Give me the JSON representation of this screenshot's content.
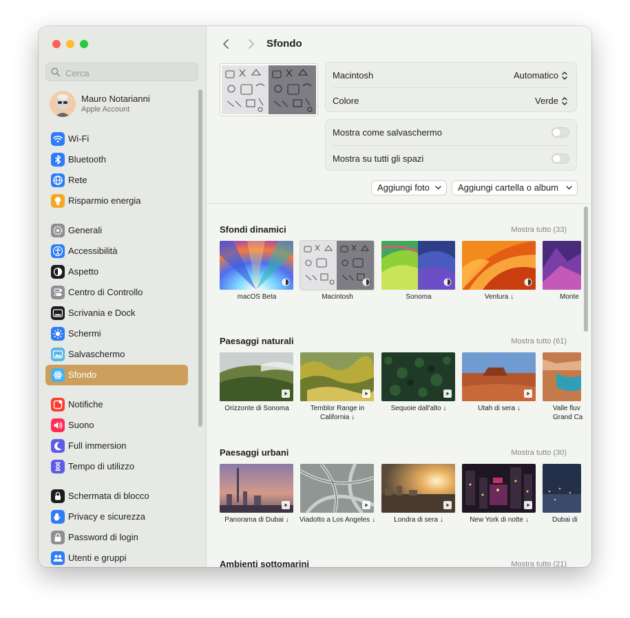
{
  "search": {
    "placeholder": "Cerca"
  },
  "account": {
    "name": "Mauro Notarianni",
    "subtitle": "Apple Account"
  },
  "sidebar": {
    "items": [
      {
        "label": "Wi-Fi",
        "icon": "wifi-icon",
        "color": "#2e7cf6"
      },
      {
        "label": "Bluetooth",
        "icon": "bluetooth-icon",
        "color": "#2e7cf6"
      },
      {
        "label": "Rete",
        "icon": "globe-icon",
        "color": "#2e7cf6"
      },
      {
        "label": "Risparmio energia",
        "icon": "battery-icon",
        "color": "#f5a623"
      },
      {
        "label": "Generali",
        "icon": "gear-icon",
        "color": "#8e8e93"
      },
      {
        "label": "Accessibilità",
        "icon": "accessibility-icon",
        "color": "#2e7cf6"
      },
      {
        "label": "Aspetto",
        "icon": "appearance-icon",
        "color": "#1c1c1e"
      },
      {
        "label": "Centro di Controllo",
        "icon": "control-center-icon",
        "color": "#8e8e93"
      },
      {
        "label": "Scrivania e Dock",
        "icon": "dock-icon",
        "color": "#1c1c1e"
      },
      {
        "label": "Schermi",
        "icon": "sun-icon",
        "color": "#2e7cf6"
      },
      {
        "label": "Salvaschermo",
        "icon": "screensaver-icon",
        "color": "#5ab4e8"
      },
      {
        "label": "Sfondo",
        "icon": "wallpaper-icon",
        "color": "#45b2f0"
      },
      {
        "label": "Notifiche",
        "icon": "bell-icon",
        "color": "#ff3b30"
      },
      {
        "label": "Suono",
        "icon": "speaker-icon",
        "color": "#ff2d55"
      },
      {
        "label": "Full immersion",
        "icon": "moon-icon",
        "color": "#5e5ce6"
      },
      {
        "label": "Tempo di utilizzo",
        "icon": "hourglass-icon",
        "color": "#5e5ce6"
      },
      {
        "label": "Schermata di blocco",
        "icon": "lock-icon",
        "color": "#1c1c1e"
      },
      {
        "label": "Privacy e sicurezza",
        "icon": "hand-icon",
        "color": "#2e7cf6"
      },
      {
        "label": "Password di login",
        "icon": "padlock-icon",
        "color": "#8e8e93"
      },
      {
        "label": "Utenti e gruppi",
        "icon": "users-icon",
        "color": "#2e7cf6"
      }
    ],
    "active_item": "Sfondo",
    "active_color": "#cc9f5d"
  },
  "header": {
    "title": "Sfondo"
  },
  "settings": {
    "wallpaper_label": "Macintosh",
    "wallpaper_value": "Automatico",
    "color_label": "Colore",
    "color_value": "Verde",
    "screensaver_label": "Mostra come salvaschermo",
    "screensaver_on": false,
    "all_spaces_label": "Mostra su tutti gli spazi",
    "all_spaces_on": false
  },
  "buttons": {
    "add_photo": "Aggiungi foto",
    "add_folder": "Aggiungi cartella o album"
  },
  "sections": [
    {
      "title": "Sfondi dinamici",
      "show_all": "Mostra tutto (33)",
      "items": [
        {
          "label": "macOS Beta",
          "badge": "dynamic-icon"
        },
        {
          "label": "Macintosh",
          "badge": "dynamic-icon"
        },
        {
          "label": "Sonoma",
          "badge": "dynamic-icon"
        },
        {
          "label": "Ventura ↓",
          "badge": "dynamic-icon"
        },
        {
          "label": "Monte",
          "badge": ""
        }
      ]
    },
    {
      "title": "Paesaggi naturali",
      "show_all": "Mostra tutto (61)",
      "items": [
        {
          "label": "Orizzonte di Sonoma",
          "badge": "play-icon"
        },
        {
          "label": "Temblor Range in California ↓",
          "badge": "play-icon"
        },
        {
          "label": "Sequoie dall'alto ↓",
          "badge": "play-icon"
        },
        {
          "label": "Utah di sera ↓",
          "badge": "play-icon"
        },
        {
          "label": "Valle fluv Grand Ca",
          "badge": ""
        }
      ]
    },
    {
      "title": "Paesaggi urbani",
      "show_all": "Mostra tutto (30)",
      "items": [
        {
          "label": "Panorama di Dubai ↓",
          "badge": "play-icon"
        },
        {
          "label": "Viadotto a Los Angeles ↓",
          "badge": "play-icon"
        },
        {
          "label": "Londra di sera ↓",
          "badge": "play-icon"
        },
        {
          "label": "New York di notte ↓",
          "badge": "play-icon"
        },
        {
          "label": "Dubai di",
          "badge": ""
        }
      ]
    },
    {
      "title": "Ambienti sottomarini",
      "show_all": "Mostra tutto (21)",
      "items": []
    }
  ]
}
